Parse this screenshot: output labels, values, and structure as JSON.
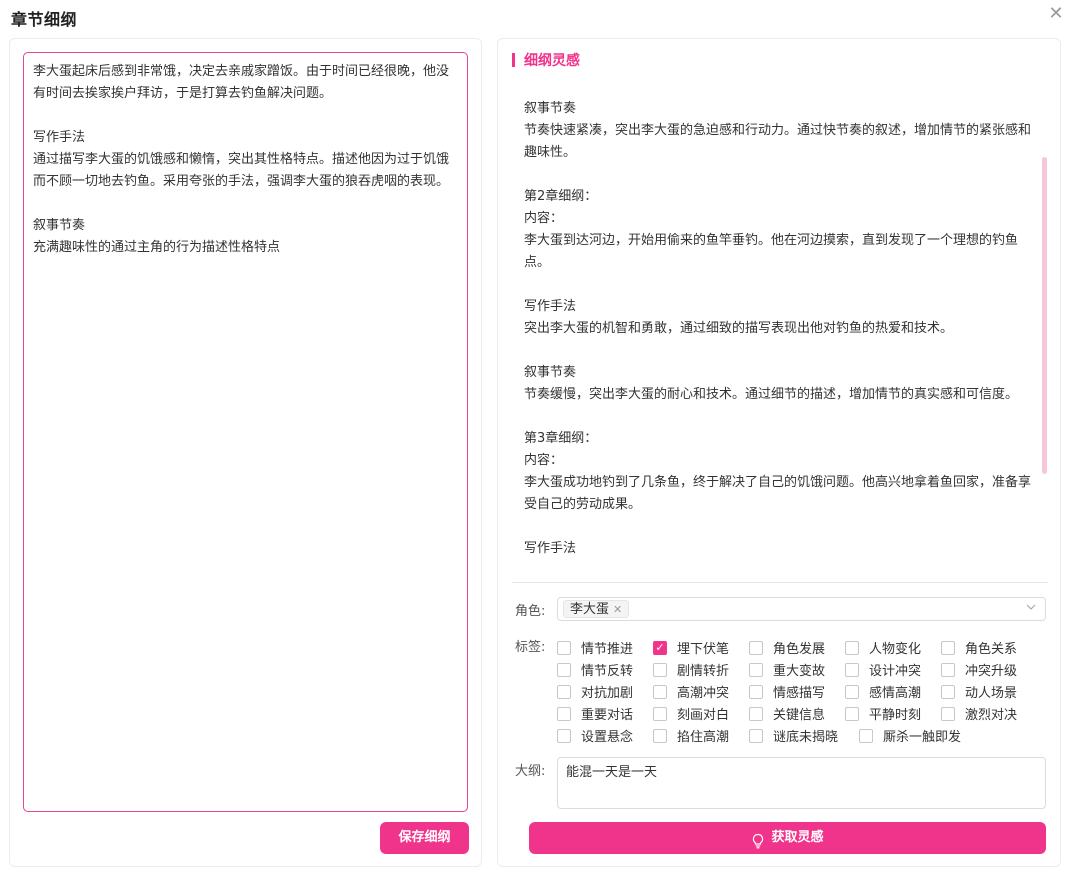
{
  "dialog": {
    "title": "章节细纲",
    "close_glyph": "✕"
  },
  "left": {
    "editor_text": "李大蛋起床后感到非常饿，决定去亲戚家蹭饭。由于时间已经很晚，他没有时间去挨家挨户拜访，于是打算去钓鱼解决问题。\n\n写作手法\n通过描写李大蛋的饥饿感和懒惰，突出其性格特点。描述他因为过于饥饿而不顾一切地去钓鱼。采用夸张的手法，强调李大蛋的狼吞虎咽的表现。\n\n叙事节奏\n充满趣味性的通过主角的行为描述性格特点",
    "save_label": "保存细纲"
  },
  "right": {
    "section_title": "细纲灵感",
    "inspiration_text": "叙事节奏\n节奏快速紧凑，突出李大蛋的急迫感和行动力。通过快节奏的叙述，增加情节的紧张感和趣味性。\n\n第2章细纲：\n内容：\n李大蛋到达河边，开始用偷来的鱼竿垂钓。他在河边摸索，直到发现了一个理想的钓鱼点。\n\n写作手法\n突出李大蛋的机智和勇敢，通过细致的描写表现出他对钓鱼的热爱和技术。\n\n叙事节奏\n节奏缓慢，突出李大蛋的耐心和技术。通过细节的描述，增加情节的真实感和可信度。\n\n第3章细纲：\n内容：\n李大蛋成功地钓到了几条鱼，终于解决了自己的饥饿问题。他高兴地拿着鱼回家，准备享受自己的劳动成果。\n\n写作手法",
    "role_label": "角色:",
    "role_tag": "李大蛋",
    "tags_label": "标签:",
    "tags": [
      {
        "label": "情节推进",
        "checked": false
      },
      {
        "label": "埋下伏笔",
        "checked": true
      },
      {
        "label": "角色发展",
        "checked": false
      },
      {
        "label": "人物变化",
        "checked": false
      },
      {
        "label": "角色关系",
        "checked": false
      },
      {
        "label": "情节反转",
        "checked": false
      },
      {
        "label": "剧情转折",
        "checked": false
      },
      {
        "label": "重大变故",
        "checked": false
      },
      {
        "label": "设计冲突",
        "checked": false
      },
      {
        "label": "冲突升级",
        "checked": false
      },
      {
        "label": "对抗加剧",
        "checked": false
      },
      {
        "label": "高潮冲突",
        "checked": false
      },
      {
        "label": "情感描写",
        "checked": false
      },
      {
        "label": "感情高潮",
        "checked": false
      },
      {
        "label": "动人场景",
        "checked": false
      },
      {
        "label": "重要对话",
        "checked": false
      },
      {
        "label": "刻画对白",
        "checked": false
      },
      {
        "label": "关键信息",
        "checked": false
      },
      {
        "label": "平静时刻",
        "checked": false
      },
      {
        "label": "激烈对决",
        "checked": false
      },
      {
        "label": "设置悬念",
        "checked": false
      },
      {
        "label": "掐住高潮",
        "checked": false
      },
      {
        "label": "谜底未揭晓",
        "checked": false
      },
      {
        "label": "厮杀一触即发",
        "checked": false
      }
    ],
    "outline_label": "大纲:",
    "outline_value": "能混一天是一天",
    "get_label": "获取灵感"
  },
  "colors": {
    "accent": "#f0348c",
    "border": "#dcdcdc"
  }
}
